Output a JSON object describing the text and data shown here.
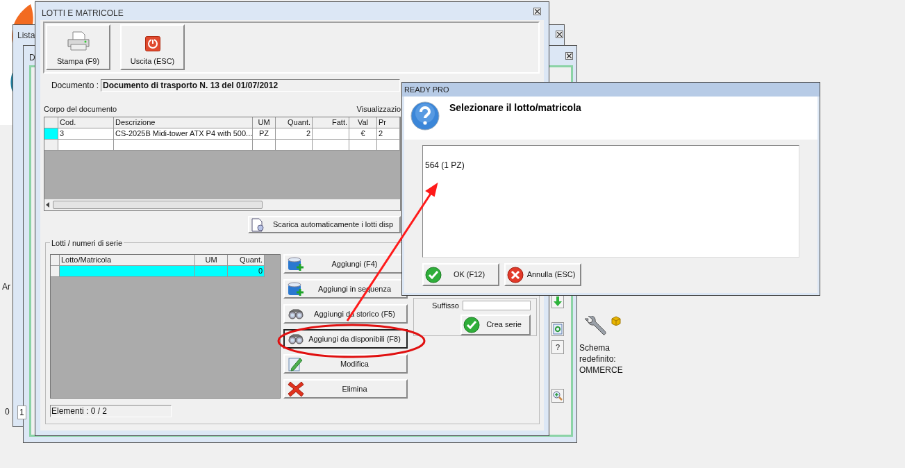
{
  "background_windows": [
    {
      "title": "Lista",
      "fragments": [
        "Ar",
        "0",
        "1"
      ]
    },
    {
      "title": "D"
    }
  ],
  "side_toolbar": [
    {
      "kind": "arrow-down"
    },
    {
      "kind": "refresh"
    },
    {
      "kind": "help",
      "label": "?"
    },
    {
      "kind": "zoom"
    }
  ],
  "desktop_icon": {
    "label": "Schema redefinito: OMMERCE"
  },
  "main_window": {
    "title": "LOTTI E MATRICOLE",
    "toolbar": [
      {
        "label": "Stampa (F9)"
      },
      {
        "label": "Uscita (ESC)"
      }
    ],
    "document": {
      "label": "Documento :",
      "value": "Documento di trasporto N. 13 del 01/07/2012"
    },
    "body": {
      "title": "Corpo del documento",
      "view_label": "Visualizzazio",
      "columns": [
        "",
        "Cod.",
        "Descrizione",
        "UM",
        "Quant.",
        "Fatt.",
        "Val",
        "Pr"
      ],
      "rows": [
        {
          "selected": true,
          "cells": [
            "",
            "3",
            "CS-2025B Midi-tower ATX P4 with 500...",
            "PZ",
            "2",
            "",
            "€",
            "2"
          ]
        },
        {
          "selected": false,
          "cells": [
            "",
            "",
            "",
            "",
            "",
            "",
            "",
            ""
          ]
        }
      ]
    },
    "download_button": "Scarica automaticamente i lotti disp",
    "lots": {
      "title": "Lotti / numeri di serie",
      "columns": [
        "",
        "Lotto/Matricola",
        "UM",
        "Quant."
      ],
      "rows": [
        {
          "selected": true,
          "cells": [
            "",
            "",
            "",
            "0"
          ]
        }
      ],
      "count": "Elementi : 0 / 2"
    },
    "actions": [
      {
        "label": "Aggiungi (F4)",
        "focused": false
      },
      {
        "label": "Aggiungi in sequenza",
        "focused": false
      },
      {
        "label": "Aggiungi da storico (F5)",
        "focused": false
      },
      {
        "label": "Aggiungi da disponibili (F8)",
        "focused": true
      },
      {
        "label": "Modifica",
        "focused": false
      },
      {
        "label": "Elimina",
        "focused": false
      }
    ],
    "series": {
      "suffix_label": "Suffisso",
      "create_label": "Crea serie"
    }
  },
  "dialog": {
    "title": "READY PRO",
    "message": "Selezionare il lotto/matricola",
    "items": [
      "564 (1 PZ)"
    ],
    "buttons": [
      {
        "label": "OK (F12)",
        "kind": "ok"
      },
      {
        "label": "Annulla (ESC)",
        "kind": "cancel"
      }
    ]
  }
}
